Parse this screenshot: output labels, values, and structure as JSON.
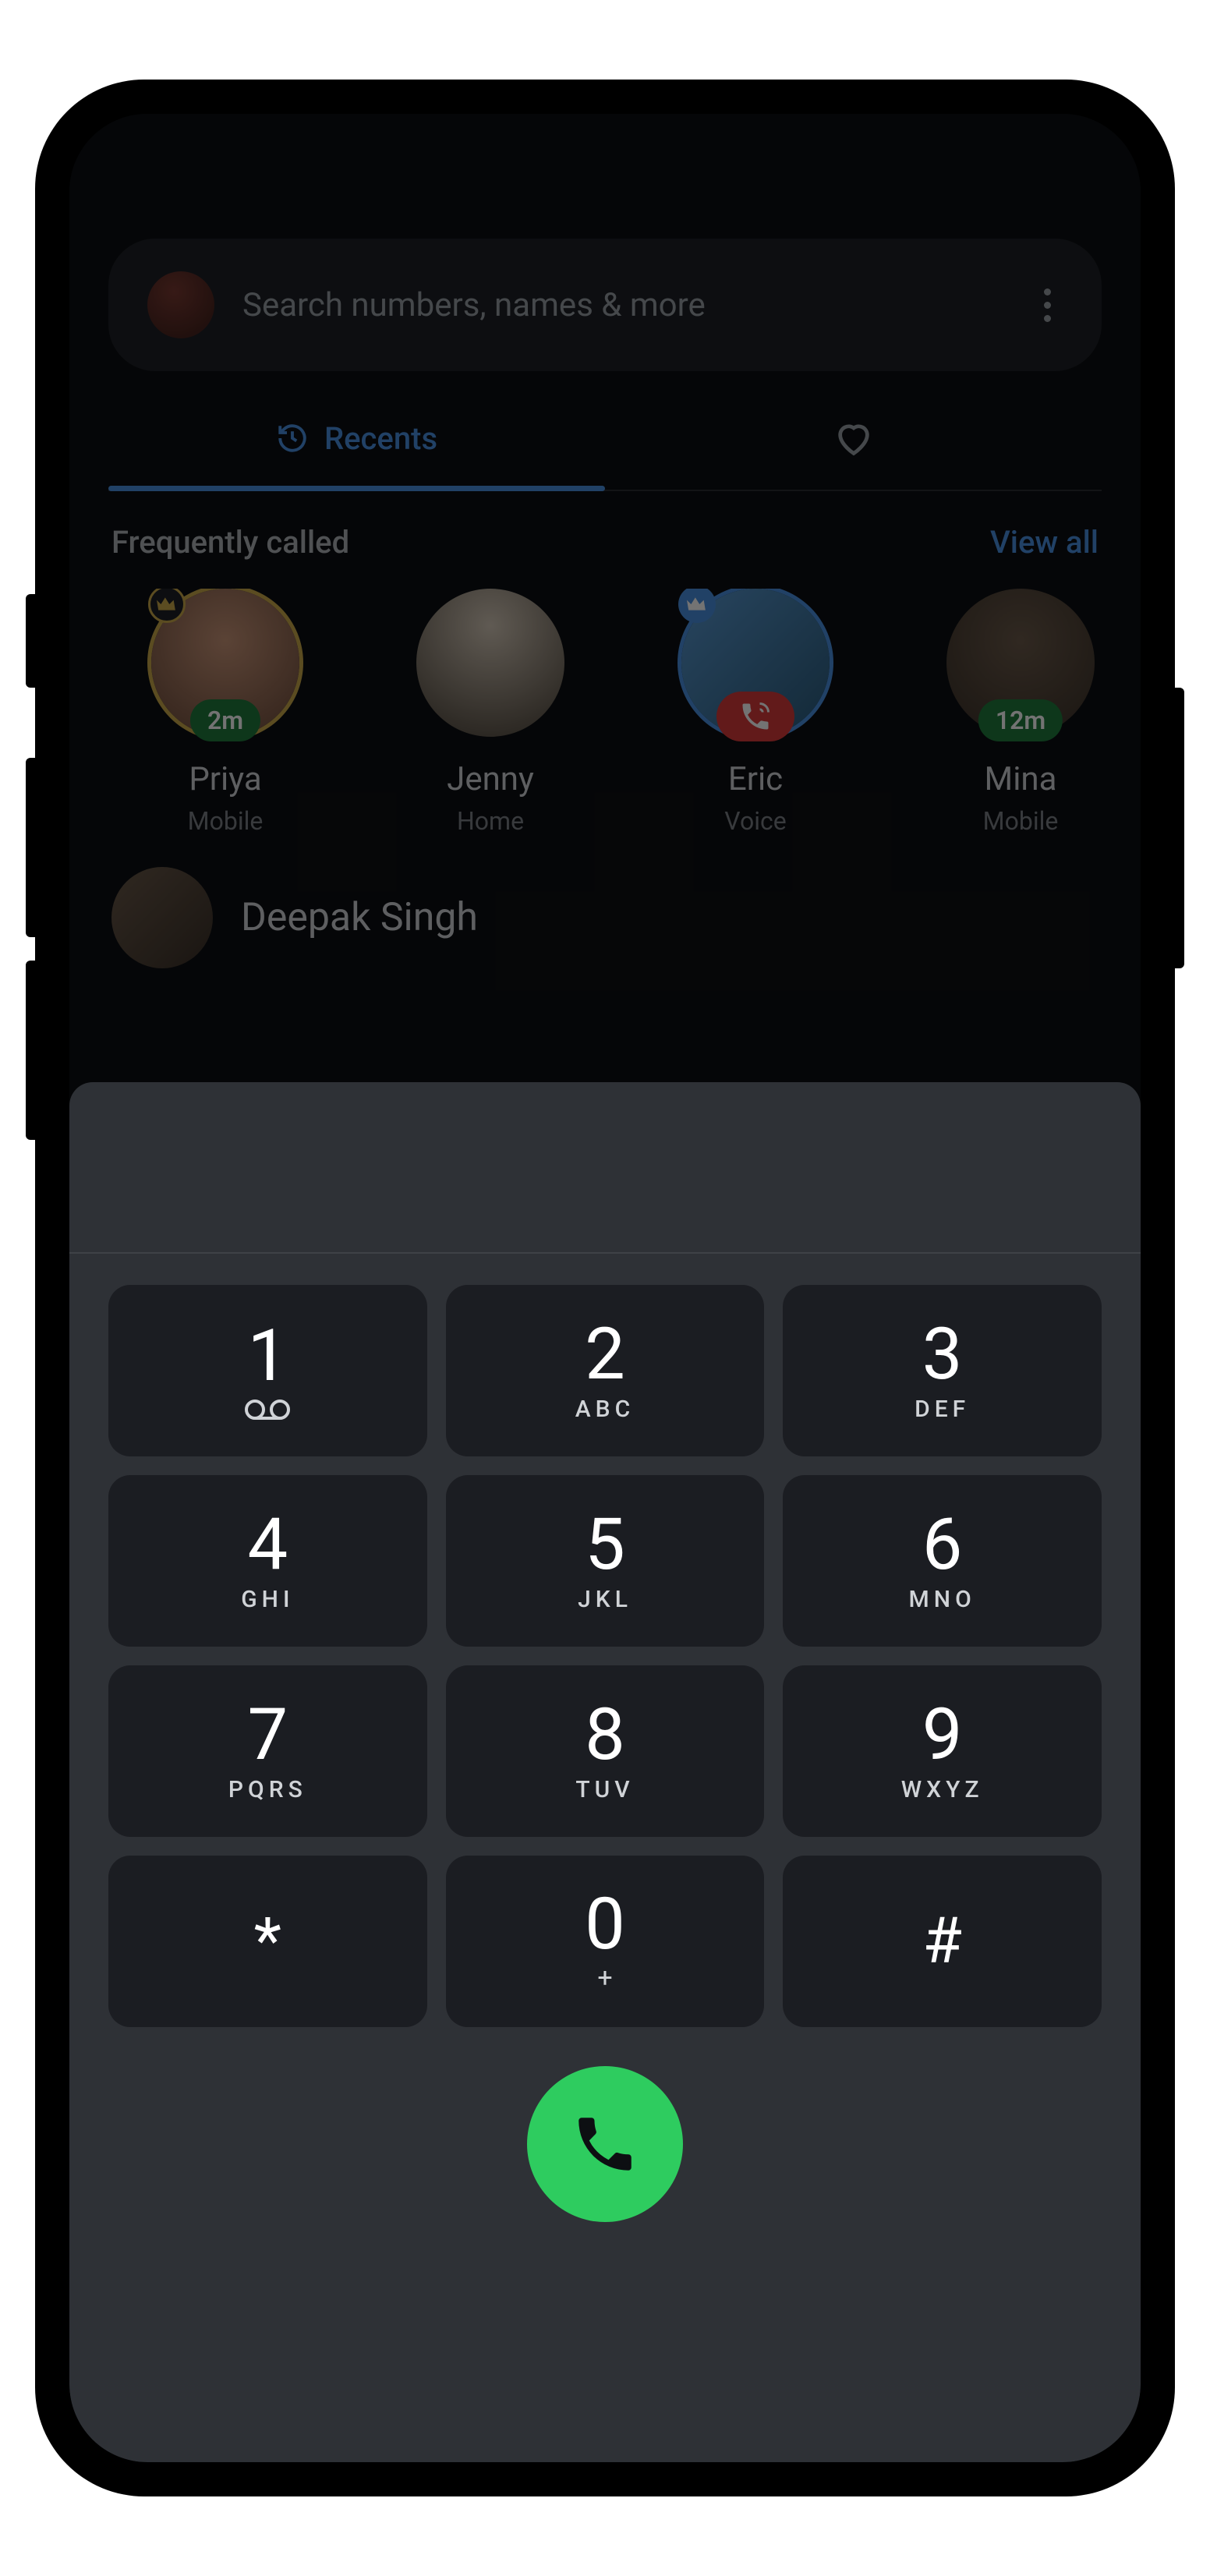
{
  "search": {
    "placeholder": "Search numbers, names & more"
  },
  "tabs": {
    "recents": "Recents"
  },
  "frequently": {
    "title": "Frequently called",
    "view_all": "View all",
    "items": [
      {
        "name": "Priya",
        "type": "Mobile",
        "time": "2m",
        "crown": "gold",
        "avatar_class": "av-priya"
      },
      {
        "name": "Jenny",
        "type": "Home",
        "time": null,
        "crown": null,
        "avatar_class": "av-jenny"
      },
      {
        "name": "Eric",
        "type": "Voice",
        "time": null,
        "crown": "blue",
        "call_badge": true,
        "avatar_class": "av-eric"
      },
      {
        "name": "Mina",
        "type": "Mobile",
        "time": "12m",
        "crown": null,
        "avatar_class": "av-mina"
      }
    ]
  },
  "recent_list": {
    "item0": {
      "name": "Deepak Singh"
    }
  },
  "keypad": [
    {
      "digit": "1",
      "letters": "",
      "sub": "vm"
    },
    {
      "digit": "2",
      "letters": "ABC",
      "sub": ""
    },
    {
      "digit": "3",
      "letters": "DEF",
      "sub": ""
    },
    {
      "digit": "4",
      "letters": "GHI",
      "sub": ""
    },
    {
      "digit": "5",
      "letters": "JKL",
      "sub": ""
    },
    {
      "digit": "6",
      "letters": "MNO",
      "sub": ""
    },
    {
      "digit": "7",
      "letters": "PQRS",
      "sub": ""
    },
    {
      "digit": "8",
      "letters": "TUV",
      "sub": ""
    },
    {
      "digit": "9",
      "letters": "WXYZ",
      "sub": ""
    },
    {
      "digit": "*",
      "letters": "",
      "sub": ""
    },
    {
      "digit": "0",
      "letters": "",
      "sub": "+"
    },
    {
      "digit": "#",
      "letters": "",
      "sub": ""
    }
  ],
  "colors": {
    "accent": "#4a90e2",
    "call_green": "#2ecc5f"
  }
}
